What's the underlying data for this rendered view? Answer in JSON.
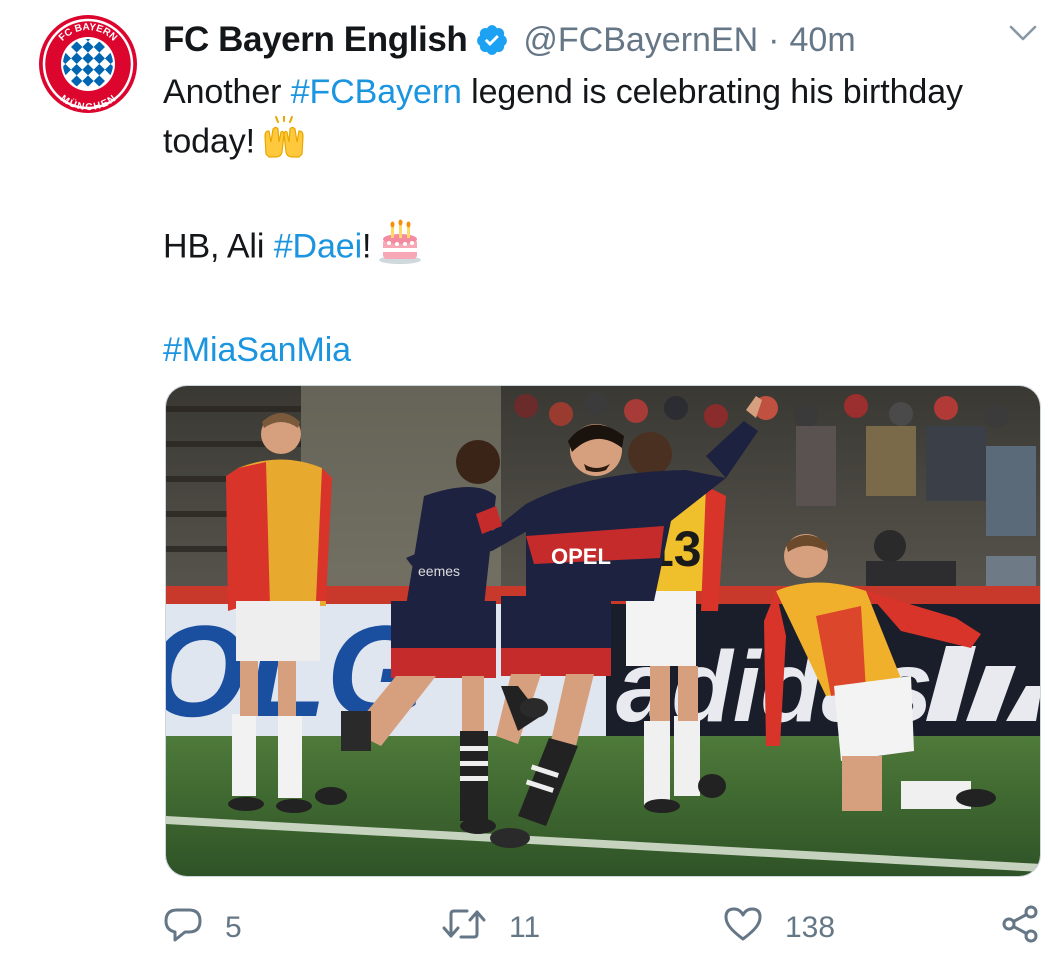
{
  "tweet": {
    "display_name": "FC Bayern English",
    "handle": "@FCBayernEN",
    "separator": "·",
    "time": "40m",
    "verified": true,
    "text": {
      "line1_pre": "Another ",
      "line1_hashtag": "#FCBayern",
      "line1_post": " legend is celebrating his birthday today!",
      "line1_emoji": "raising-hands-emoji",
      "line2_pre": "HB, Ali ",
      "line2_hashtag": "#Daei",
      "line2_post": "!",
      "line2_emoji": "birthday-cake-emoji",
      "line3_hashtag": "#MiaSanMia"
    },
    "avatar": {
      "logo_text_top": "FC BAYERN",
      "logo_text_bottom": "MÜNCHEN"
    },
    "media": {
      "jersey_number": "13",
      "sponsor_text": "OPEL",
      "board_text_left": "OLG",
      "board_text_right": "adidas"
    },
    "actions": {
      "replies": "5",
      "retweets": "11",
      "likes": "138"
    }
  },
  "colors": {
    "link": "#1b95e0",
    "muted": "#657786",
    "verified": "#1da1f2",
    "bayern_red": "#dc052d",
    "bayern_blue": "#0066b2"
  }
}
